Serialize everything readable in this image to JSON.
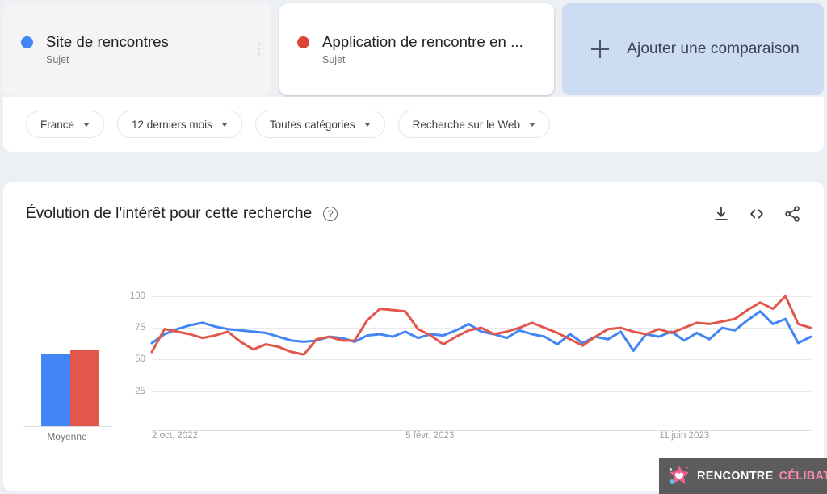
{
  "comparison_cards": [
    {
      "label": "Site de rencontres",
      "sublabel": "Sujet",
      "color": "#4285f4",
      "dot": "blue-dot-icon",
      "menu": "more-options-icon"
    },
    {
      "label": "Application de rencontre en ...",
      "sublabel": "Sujet",
      "color": "#db4437",
      "dot": "red-dot-icon"
    },
    {
      "label": "Ajouter une comparaison",
      "icon": "plus-icon",
      "color": "#ccdcf2"
    }
  ],
  "filters": [
    {
      "label": "France",
      "icon": "chevron-down-icon"
    },
    {
      "label": "12 derniers mois",
      "icon": "chevron-down-icon"
    },
    {
      "label": "Toutes catégories",
      "icon": "chevron-down-icon"
    },
    {
      "label": "Recherche sur le Web",
      "icon": "chevron-down-icon"
    }
  ],
  "chart_panel": {
    "title": "Évolution de l'intérêt pour cette recherche",
    "help_icon": "help-circle-icon",
    "help_glyph": "?",
    "actions": [
      {
        "name": "download-icon",
        "tooltip": "Télécharger"
      },
      {
        "name": "embed-code-icon",
        "tooltip": "Intégrer"
      },
      {
        "name": "share-icon",
        "tooltip": "Partager"
      }
    ]
  },
  "average_panel": {
    "label": "Moyenne",
    "bars": [
      {
        "series": "Site de rencontres",
        "value": 66,
        "color": "#4285f4"
      },
      {
        "series": "Application de rencontre en ...",
        "value": 70,
        "color": "#e2574c"
      }
    ]
  },
  "watermark": {
    "text_primary": "RENCONTRE",
    "text_secondary": "CÉLIBATAIRE",
    "icon": "star-heart-logo-icon",
    "background": "#5c5c5c"
  },
  "chart_data": {
    "type": "line",
    "title": "Évolution de l'intérêt pour cette recherche",
    "xlabel": "",
    "ylabel": "",
    "ylim": [
      0,
      112
    ],
    "yticks": [
      100,
      75,
      50,
      25
    ],
    "grid": true,
    "legend_position": "top-cards",
    "xtick_labels": [
      "2 oct. 2022",
      "5 févr. 2023",
      "11 juin 2023"
    ],
    "xtick_positions": [
      0,
      0.385,
      0.77
    ],
    "n_points": 53,
    "series": [
      {
        "name": "Site de rencontres",
        "color": "#4285f4",
        "values": [
          63,
          70,
          74,
          77,
          79,
          76,
          74,
          73,
          72,
          71,
          68,
          65,
          64,
          65,
          68,
          67,
          64,
          69,
          70,
          68,
          72,
          67,
          70,
          69,
          73,
          78,
          72,
          70,
          67,
          73,
          70,
          68,
          62,
          70,
          63,
          68,
          66,
          72,
          57,
          70,
          68,
          72,
          65,
          71,
          66,
          75,
          73,
          81,
          88,
          78,
          82,
          63,
          68
        ]
      },
      {
        "name": "Application de rencontre en ...",
        "color": "#e2574c",
        "values": [
          56,
          74,
          72,
          70,
          67,
          69,
          72,
          64,
          58,
          62,
          60,
          56,
          54,
          66,
          68,
          65,
          65,
          81,
          90,
          89,
          88,
          74,
          69,
          62,
          68,
          73,
          75,
          70,
          72,
          75,
          79,
          75,
          71,
          66,
          61,
          68,
          74,
          75,
          72,
          70,
          74,
          71,
          75,
          79,
          78,
          80,
          82,
          89,
          95,
          90,
          100,
          78,
          75
        ]
      }
    ]
  }
}
